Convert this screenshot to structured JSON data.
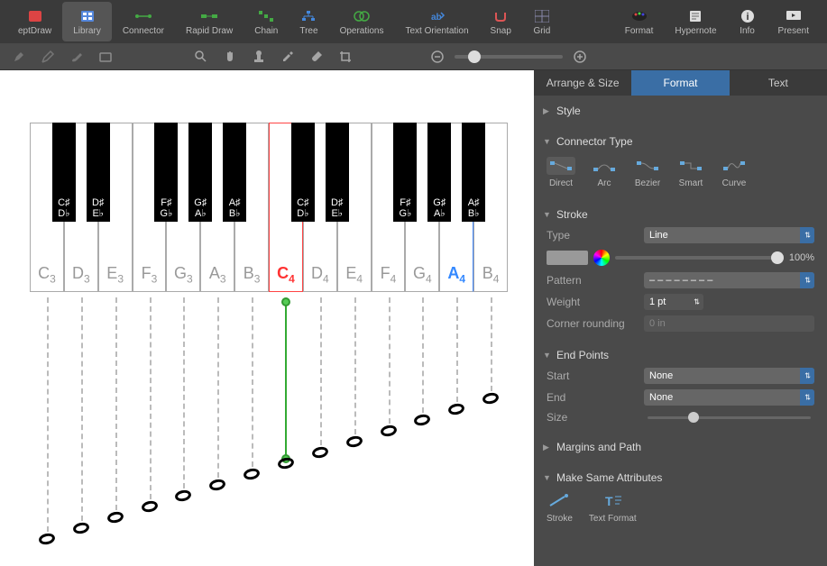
{
  "toolbar": {
    "items": [
      {
        "label": "eptDraw",
        "icon": "app"
      },
      {
        "label": "Library",
        "icon": "library",
        "active": true
      },
      {
        "label": "Connector",
        "icon": "connector"
      },
      {
        "label": "Rapid Draw",
        "icon": "rapid"
      },
      {
        "label": "Chain",
        "icon": "chain"
      },
      {
        "label": "Tree",
        "icon": "tree"
      },
      {
        "label": "Operations",
        "icon": "operations"
      },
      {
        "label": "Text Orientation",
        "icon": "textorient"
      },
      {
        "label": "Snap",
        "icon": "snap"
      },
      {
        "label": "Grid",
        "icon": "grid"
      }
    ],
    "right_items": [
      {
        "label": "Format",
        "icon": "format"
      },
      {
        "label": "Hypernote",
        "icon": "hypernote"
      },
      {
        "label": "Info",
        "icon": "info"
      },
      {
        "label": "Present",
        "icon": "present"
      }
    ]
  },
  "piano": {
    "white_keys": [
      {
        "note": "C",
        "oct": "3"
      },
      {
        "note": "D",
        "oct": "3"
      },
      {
        "note": "E",
        "oct": "3"
      },
      {
        "note": "F",
        "oct": "3"
      },
      {
        "note": "G",
        "oct": "3"
      },
      {
        "note": "A",
        "oct": "3"
      },
      {
        "note": "B",
        "oct": "3"
      },
      {
        "note": "C",
        "oct": "4",
        "style": "red"
      },
      {
        "note": "D",
        "oct": "4"
      },
      {
        "note": "E",
        "oct": "4"
      },
      {
        "note": "F",
        "oct": "4"
      },
      {
        "note": "G",
        "oct": "4"
      },
      {
        "note": "A",
        "oct": "4",
        "style": "blue"
      },
      {
        "note": "B",
        "oct": "4"
      }
    ],
    "black_keys": [
      {
        "pos": 0,
        "sharp": "C♯",
        "flat": "D♭"
      },
      {
        "pos": 1,
        "sharp": "D♯",
        "flat": "E♭"
      },
      {
        "pos": 3,
        "sharp": "F♯",
        "flat": "G♭"
      },
      {
        "pos": 4,
        "sharp": "G♯",
        "flat": "A♭"
      },
      {
        "pos": 5,
        "sharp": "A♯",
        "flat": "B♭"
      },
      {
        "pos": 7,
        "sharp": "C♯",
        "flat": "D♭"
      },
      {
        "pos": 8,
        "sharp": "D♯",
        "flat": "E♭"
      },
      {
        "pos": 10,
        "sharp": "F♯",
        "flat": "G♭"
      },
      {
        "pos": 11,
        "sharp": "G♯",
        "flat": "A♭"
      },
      {
        "pos": 12,
        "sharp": "A♯",
        "flat": "B♭"
      }
    ]
  },
  "panel": {
    "tabs": [
      "Arrange & Size",
      "Format",
      "Text"
    ],
    "active_tab": "Format",
    "sections": {
      "style": "Style",
      "connector_type": "Connector Type",
      "stroke": "Stroke",
      "end_points": "End Points",
      "margins": "Margins and Path",
      "same_attr": "Make Same Attributes"
    },
    "connectors": [
      {
        "name": "Direct",
        "selected": true
      },
      {
        "name": "Arc"
      },
      {
        "name": "Bezier"
      },
      {
        "name": "Smart"
      },
      {
        "name": "Curve"
      }
    ],
    "stroke": {
      "type_label": "Type",
      "type_value": "Line",
      "opacity": "100%",
      "pattern_label": "Pattern",
      "pattern_value": "– – – – – – – –",
      "weight_label": "Weight",
      "weight_value": "1 pt",
      "corner_label": "Corner rounding",
      "corner_value": "0 in"
    },
    "endpoints": {
      "start_label": "Start",
      "start_value": "None",
      "end_label": "End",
      "end_value": "None",
      "size_label": "Size"
    },
    "same_attrs": [
      "Stroke",
      "Text Format"
    ]
  }
}
